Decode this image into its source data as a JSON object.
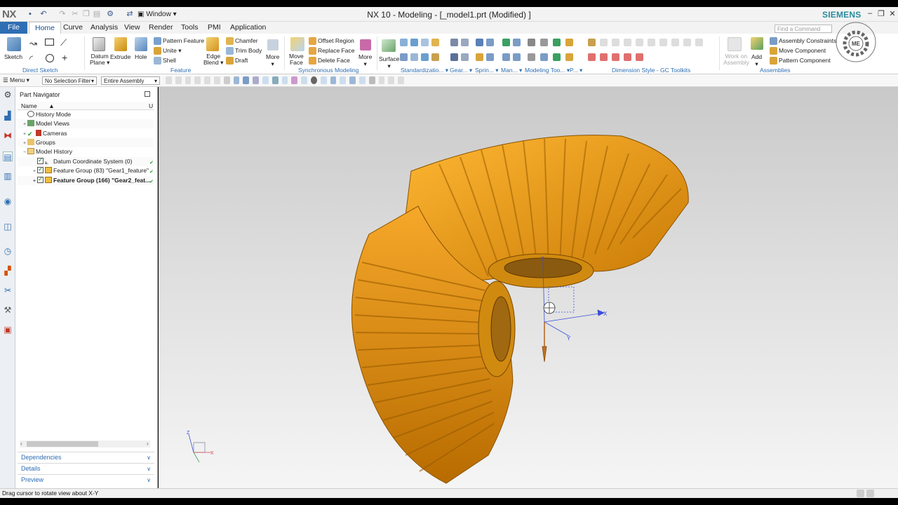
{
  "app": {
    "logo": "NX",
    "window_menu": "Window",
    "title": "NX 10 - Modeling - [_model1.prt (Modified) ]",
    "brand": "SIEMENS",
    "brand_color": "#2b8a9d"
  },
  "ribbon": {
    "tabs": [
      "File",
      "Home",
      "Curve",
      "Analysis",
      "View",
      "Render",
      "Tools",
      "PMI",
      "Application"
    ],
    "active_tab": "Home",
    "find_placeholder": "Find a Command",
    "direct_sketch": {
      "label": "Direct Sketch",
      "sketch": "Sketch"
    },
    "feature": {
      "label": "Feature",
      "datum_plane": [
        "Datum",
        "Plane"
      ],
      "extrude": "Extrude",
      "hole": "Hole",
      "pattern_feature": "Pattern Feature",
      "unite": "Unite",
      "shell": "Shell",
      "edge_blend": [
        "Edge",
        "Blend"
      ],
      "chamfer": "Chamfer",
      "trim_body": "Trim Body",
      "draft": "Draft",
      "more": "More"
    },
    "sync": {
      "label": "Synchronous Modeling",
      "move_face": [
        "Move",
        "Face"
      ],
      "offset_region": "Offset Region",
      "replace_face": "Replace Face",
      "delete_face": "Delete Face",
      "more": "More"
    },
    "surface": "Surface",
    "groups_small": [
      "Standardizatio...",
      "Gear...",
      "Sprin...",
      "Man...",
      "Modeling Too...",
      "P..."
    ],
    "dimension_style": "Dimension Style - GC Toolkits",
    "assemblies": {
      "label": "Assemblies",
      "work_on": [
        "Work on",
        "Assembly"
      ],
      "add": "Add",
      "constraints": "Assembly Constraints",
      "move_component": "Move Component",
      "pattern_component": "Pattern Component"
    }
  },
  "selection_bar": {
    "menu": "Menu",
    "filter": "No Selection Filter",
    "scope": "Entire Assembly"
  },
  "part_navigator": {
    "title": "Part Navigator",
    "col_name": "Name",
    "col_u": "U",
    "rows": [
      {
        "label": "History Mode"
      },
      {
        "label": "Model Views"
      },
      {
        "label": "Cameras"
      },
      {
        "label": "Groups"
      },
      {
        "label": "Model History"
      },
      {
        "label": "Datum Coordinate System (0)"
      },
      {
        "label": "Feature Group (83) \"Gear1_feature\""
      },
      {
        "label": "Feature Group (166) \"Gear2_feat..."
      }
    ],
    "panels": [
      "Dependencies",
      "Details",
      "Preview"
    ]
  },
  "viewport": {
    "gear_color": "#f0a020",
    "axis_labels": {
      "x": "X",
      "y": "Y",
      "z": "Z"
    }
  },
  "status": {
    "text": "Drag cursor to rotate view about X-Y"
  }
}
